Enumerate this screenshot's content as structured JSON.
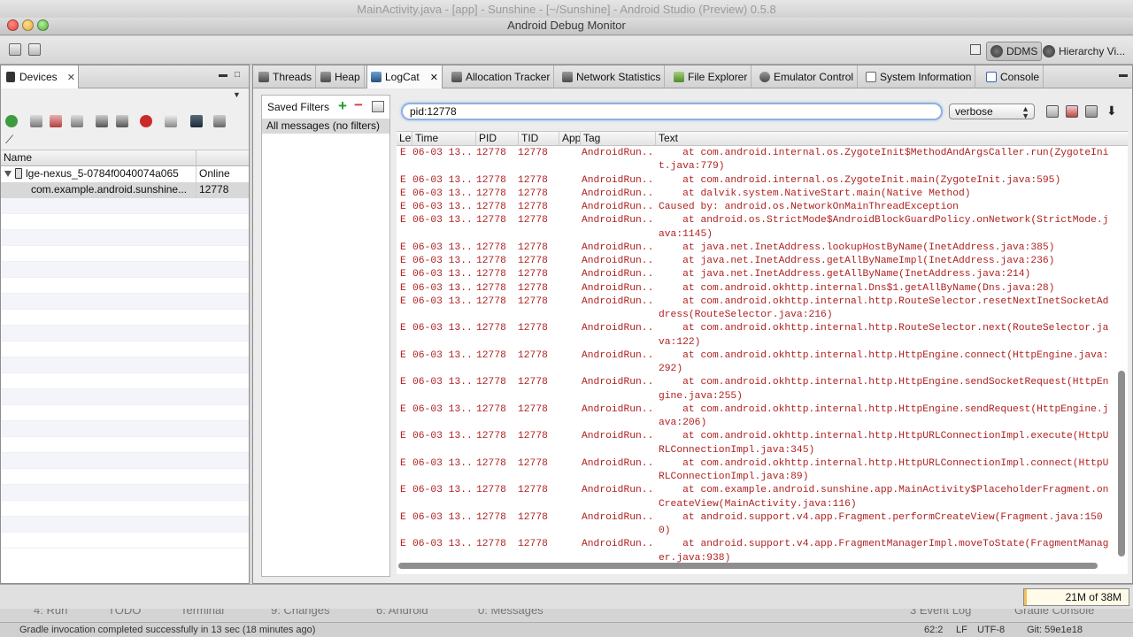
{
  "background_window": {
    "title": "MainActivity.java - [app] - Sunshine - [~/Sunshine] - Android Studio (Preview) 0.5.8"
  },
  "window": {
    "title": "Android Debug Monitor"
  },
  "perspectives": [
    {
      "label": "DDMS",
      "icon": "ddms-icon"
    },
    {
      "label": "Hierarchy Vi...",
      "icon": "hierarchy-viewer-icon"
    }
  ],
  "devices_panel": {
    "tab_label": "Devices",
    "columns": [
      "Name",
      ""
    ],
    "device": {
      "name": "lge-nexus_5-0784f0040074a065",
      "status": "Online"
    },
    "process": {
      "name": "com.example.android.sunshine...",
      "pid": "12778"
    }
  },
  "tabs": [
    {
      "label": "Threads"
    },
    {
      "label": "Heap"
    },
    {
      "label": "LogCat"
    },
    {
      "label": "Allocation Tracker"
    },
    {
      "label": "Network Statistics"
    },
    {
      "label": "File Explorer"
    },
    {
      "label": "Emulator Control"
    },
    {
      "label": "System Information"
    },
    {
      "label": "Console"
    }
  ],
  "logcat": {
    "saved_filters_label": "Saved Filters",
    "filter_item": "All messages (no filters)",
    "search_value": "pid:12778",
    "level": "verbose",
    "columns": [
      "Lev",
      "Time",
      "PID",
      "TID",
      "App",
      "Tag",
      "Text"
    ],
    "rows": [
      {
        "level": "E",
        "time": "06-03 13...",
        "pid": "12778",
        "tid": "12778",
        "tag": "AndroidRun...",
        "text": "    at com.android.internal.os.ZygoteInit$MethodAndArgsCaller.run(ZygoteInit.java:779)"
      },
      {
        "level": "E",
        "time": "06-03 13...",
        "pid": "12778",
        "tid": "12778",
        "tag": "AndroidRun...",
        "text": "    at com.android.internal.os.ZygoteInit.main(ZygoteInit.java:595)"
      },
      {
        "level": "E",
        "time": "06-03 13...",
        "pid": "12778",
        "tid": "12778",
        "tag": "AndroidRun...",
        "text": "    at dalvik.system.NativeStart.main(Native Method)"
      },
      {
        "level": "E",
        "time": "06-03 13...",
        "pid": "12778",
        "tid": "12778",
        "tag": "AndroidRun...",
        "text": "Caused by: android.os.NetworkOnMainThreadException"
      },
      {
        "level": "E",
        "time": "06-03 13...",
        "pid": "12778",
        "tid": "12778",
        "tag": "AndroidRun...",
        "text": "    at android.os.StrictMode$AndroidBlockGuardPolicy.onNetwork(StrictMode.java:1145)"
      },
      {
        "level": "E",
        "time": "06-03 13...",
        "pid": "12778",
        "tid": "12778",
        "tag": "AndroidRun...",
        "text": "    at java.net.InetAddress.lookupHostByName(InetAddress.java:385)"
      },
      {
        "level": "E",
        "time": "06-03 13...",
        "pid": "12778",
        "tid": "12778",
        "tag": "AndroidRun...",
        "text": "    at java.net.InetAddress.getAllByNameImpl(InetAddress.java:236)"
      },
      {
        "level": "E",
        "time": "06-03 13...",
        "pid": "12778",
        "tid": "12778",
        "tag": "AndroidRun...",
        "text": "    at java.net.InetAddress.getAllByName(InetAddress.java:214)"
      },
      {
        "level": "E",
        "time": "06-03 13...",
        "pid": "12778",
        "tid": "12778",
        "tag": "AndroidRun...",
        "text": "    at com.android.okhttp.internal.Dns$1.getAllByName(Dns.java:28)"
      },
      {
        "level": "E",
        "time": "06-03 13...",
        "pid": "12778",
        "tid": "12778",
        "tag": "AndroidRun...",
        "text": "    at com.android.okhttp.internal.http.RouteSelector.resetNextInetSocketAddress(RouteSelector.java:216)"
      },
      {
        "level": "E",
        "time": "06-03 13...",
        "pid": "12778",
        "tid": "12778",
        "tag": "AndroidRun...",
        "text": "    at com.android.okhttp.internal.http.RouteSelector.next(RouteSelector.java:122)"
      },
      {
        "level": "E",
        "time": "06-03 13...",
        "pid": "12778",
        "tid": "12778",
        "tag": "AndroidRun...",
        "text": "    at com.android.okhttp.internal.http.HttpEngine.connect(HttpEngine.java:292)"
      },
      {
        "level": "E",
        "time": "06-03 13...",
        "pid": "12778",
        "tid": "12778",
        "tag": "AndroidRun...",
        "text": "    at com.android.okhttp.internal.http.HttpEngine.sendSocketRequest(HttpEngine.java:255)"
      },
      {
        "level": "E",
        "time": "06-03 13...",
        "pid": "12778",
        "tid": "12778",
        "tag": "AndroidRun...",
        "text": "    at com.android.okhttp.internal.http.HttpEngine.sendRequest(HttpEngine.java:206)"
      },
      {
        "level": "E",
        "time": "06-03 13...",
        "pid": "12778",
        "tid": "12778",
        "tag": "AndroidRun...",
        "text": "    at com.android.okhttp.internal.http.HttpURLConnectionImpl.execute(HttpURLConnectionImpl.java:345)"
      },
      {
        "level": "E",
        "time": "06-03 13...",
        "pid": "12778",
        "tid": "12778",
        "tag": "AndroidRun...",
        "text": "    at com.android.okhttp.internal.http.HttpURLConnectionImpl.connect(HttpURLConnectionImpl.java:89)"
      },
      {
        "level": "E",
        "time": "06-03 13...",
        "pid": "12778",
        "tid": "12778",
        "tag": "AndroidRun...",
        "text": "    at com.example.android.sunshine.app.MainActivity$PlaceholderFragment.onCreateView(MainActivity.java:116)"
      },
      {
        "level": "E",
        "time": "06-03 13...",
        "pid": "12778",
        "tid": "12778",
        "tag": "AndroidRun...",
        "text": "    at android.support.v4.app.Fragment.performCreateView(Fragment.java:1500)"
      },
      {
        "level": "E",
        "time": "06-03 13...",
        "pid": "12778",
        "tid": "12778",
        "tag": "AndroidRun...",
        "text": "    at android.support.v4.app.FragmentManagerImpl.moveToState(FragmentManager.java:938)"
      }
    ]
  },
  "memory": {
    "label": "21M of 38M"
  },
  "bg_tool_windows": [
    "4: Run",
    "TODO",
    "Terminal",
    "9: Changes",
    "6: Android",
    "0: Messages",
    "3 Event Log",
    "Gradle Console"
  ],
  "bg_status": {
    "message": "Gradle invocation completed successfully in 13 sec (18 minutes ago)",
    "position": "62:2",
    "line_sep": "LF",
    "encoding": "UTF-8",
    "vcs": "Git: 59e1e18"
  },
  "colors": {
    "log_error": "#b02121",
    "selection": "#d8d8d8",
    "search_focus": "#8fb1e0"
  }
}
